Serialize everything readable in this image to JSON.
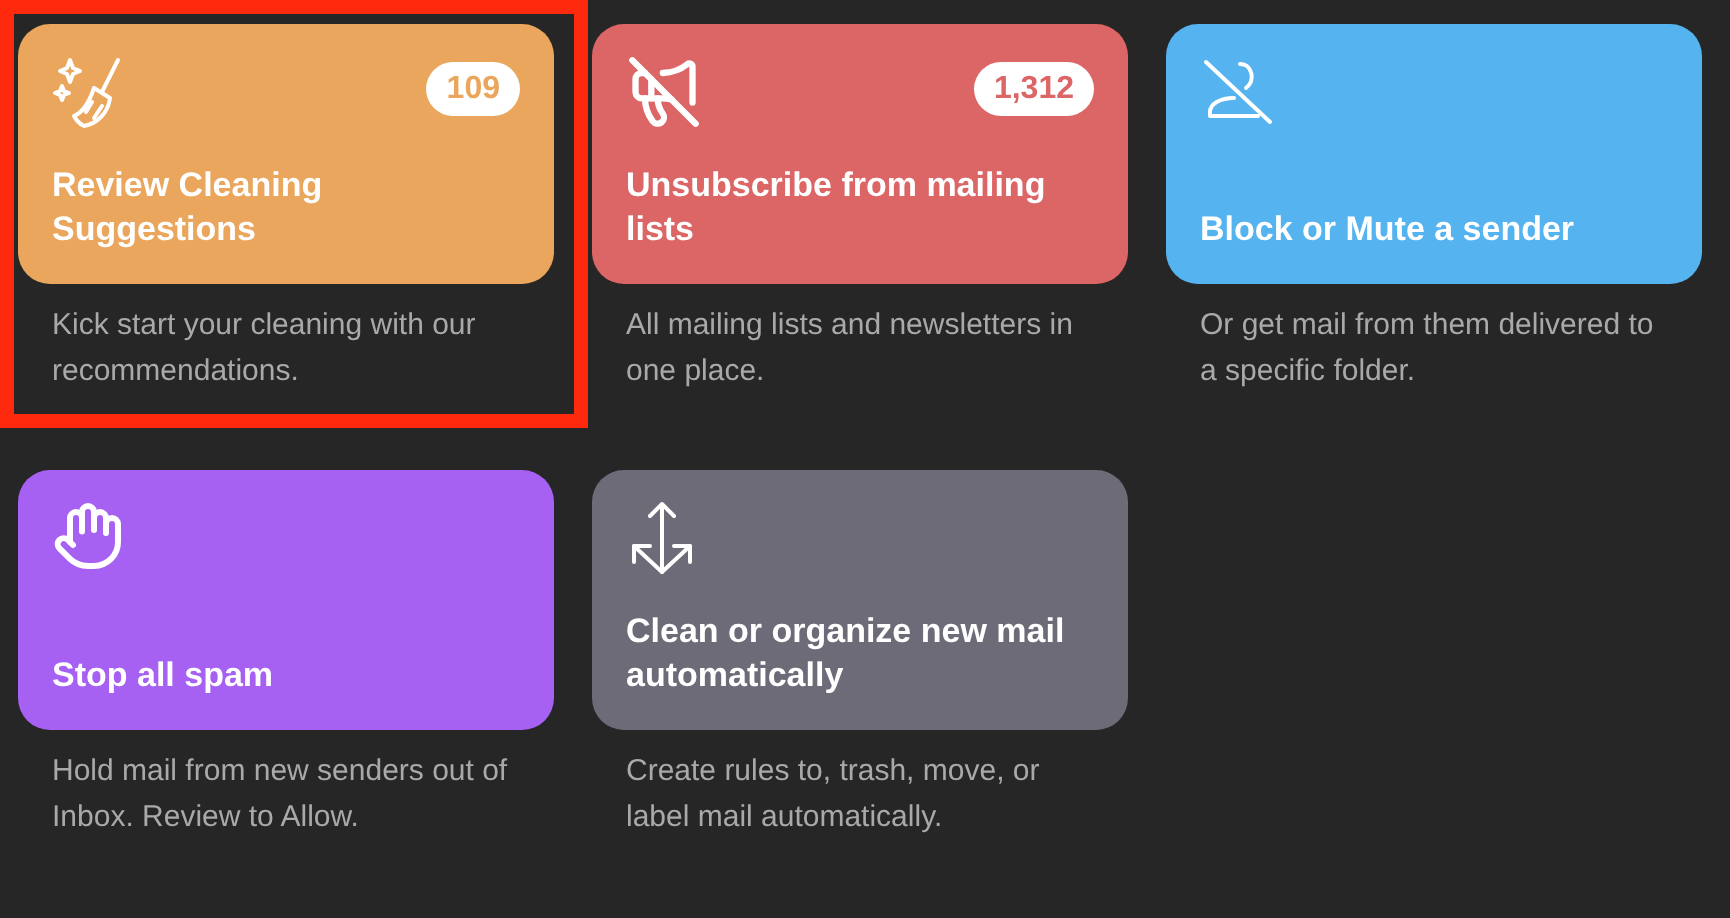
{
  "cards": [
    {
      "title": "Review Cleaning Suggestions",
      "count": "109",
      "description": "Kick start your cleaning with our recommendations.",
      "color": "#e9a65c",
      "selected": true
    },
    {
      "title": "Unsubscribe from mailing lists",
      "count": "1,312",
      "description": "All mailing lists and newsletters in one place.",
      "color": "#dc6566",
      "selected": false
    },
    {
      "title": "Block or Mute a sender",
      "description": "Or get mail from them delivered to a specific folder.",
      "color": "#55b3f0",
      "selected": false
    },
    {
      "title": "Stop all spam",
      "description": "Hold mail from new senders out of Inbox. Review to Allow.",
      "color": "#a660f2",
      "selected": false
    },
    {
      "title": "Clean or organize new mail automatically",
      "description": "Create rules to, trash, move, or label mail automatically.",
      "color": "#6e6b79",
      "selected": false
    }
  ]
}
